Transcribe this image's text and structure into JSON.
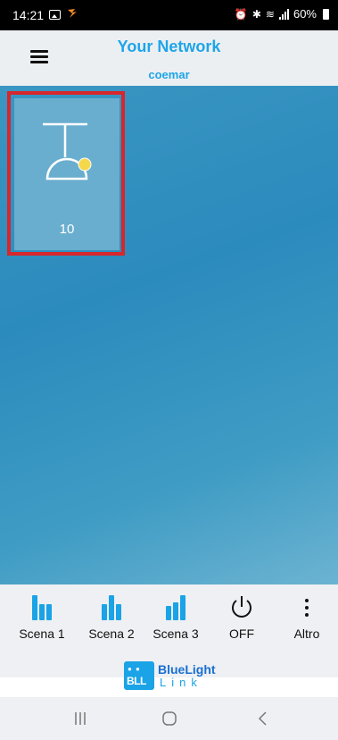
{
  "status": {
    "time": "14:21",
    "battery": "60%"
  },
  "header": {
    "title": "Your Network",
    "subtitle": "coemar"
  },
  "tile": {
    "label": "10",
    "indicator_color": "#f5d84a"
  },
  "bottom": {
    "buttons": [
      {
        "label": "Scena 1",
        "icon": "scene1-icon"
      },
      {
        "label": "Scena 2",
        "icon": "scene2-icon"
      },
      {
        "label": "Scena 3",
        "icon": "scene3-icon"
      },
      {
        "label": "OFF",
        "icon": "power-icon"
      },
      {
        "label": "Altro",
        "icon": "more-icon"
      }
    ]
  },
  "brand": {
    "logo_text": "BLL",
    "name": "BlueLight",
    "subname": "Link"
  },
  "colors": {
    "accent": "#1ea5e8",
    "highlight": "#d7262c",
    "background_top": "#3a96c2"
  }
}
